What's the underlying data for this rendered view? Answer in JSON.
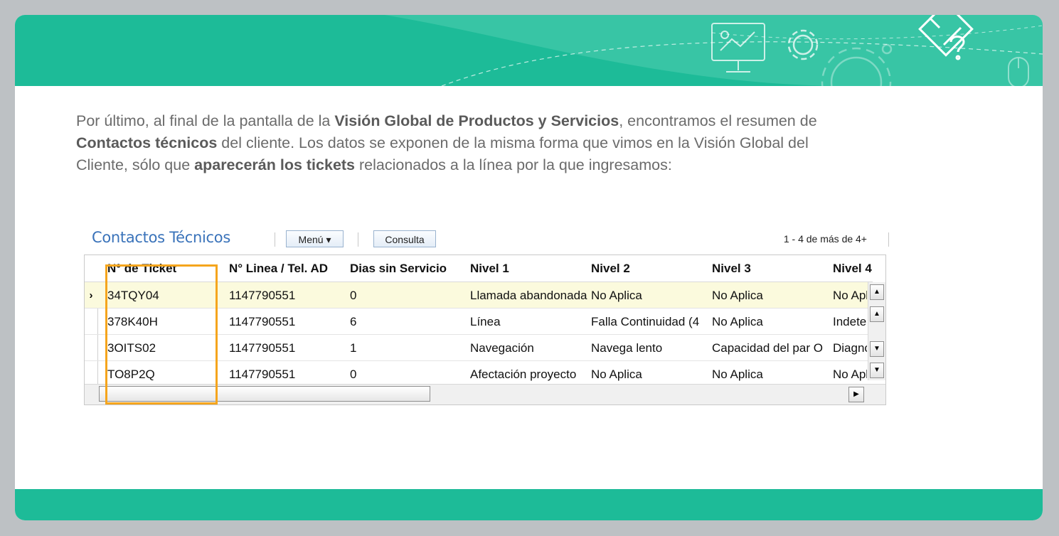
{
  "intro": {
    "p1": "Por último, al final de la pantalla de la ",
    "b1": "Visión Global de Productos y Servicios",
    "p2": ", encontramos el resumen de",
    "b2": "Contactos técnicos",
    "p3": " del cliente. Los datos se exponen de la misma forma que vimos en la Visión Global del",
    "p4": "Cliente, sólo que ",
    "b3": "aparecerán los tickets",
    "p5": " relacionados a la línea por la que ingresamos:"
  },
  "grid": {
    "title": "Contactos Técnicos",
    "menu_button": "Menú ▾",
    "query_button": "Consulta",
    "pager": "1 - 4 de más de 4+",
    "columns": [
      "N° de Ticket",
      "N° Linea / Tel. AD",
      "Dias sin Servicio",
      "Nivel 1",
      "Nivel 2",
      "Nivel 3",
      "Nivel 4"
    ],
    "rows": [
      [
        "34TQY04",
        "1147790551",
        "0",
        "Llamada abandonada",
        "No Aplica",
        "No Aplica",
        "No Aplica"
      ],
      [
        "378K40H",
        "1147790551",
        "6",
        "Línea",
        "Falla Continuidad (4",
        "No Aplica",
        "Indeterminado"
      ],
      [
        "3OITS02",
        "1147790551",
        "1",
        "Navegación",
        "Navega lento",
        "Capacidad del par O",
        "Diagnóstico"
      ],
      [
        "TO8P2Q",
        "1147790551",
        "0",
        "Afectación proyecto",
        "No Aplica",
        "No Aplica",
        "No Aplica"
      ]
    ],
    "selected_marker": "›"
  },
  "colors": {
    "banner": "#1dbb98",
    "highlight": "#f5a51d",
    "title": "#3a73ba",
    "selected_row": "#fbfadd"
  },
  "icons": [
    "presentation-screen-icon",
    "gear-icon",
    "diamond-logo-icon",
    "mouse-icon"
  ]
}
